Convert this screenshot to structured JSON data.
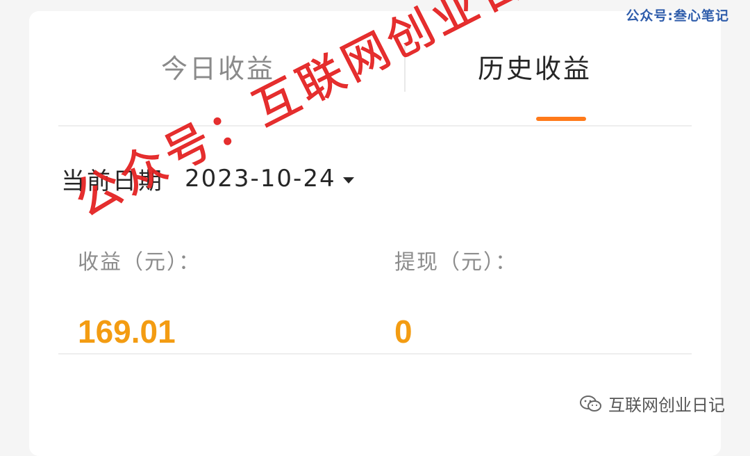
{
  "tabs": {
    "today": "今日收益",
    "history": "历史收益"
  },
  "date": {
    "label": "当前日期",
    "value": "2023-10-24"
  },
  "stats": {
    "income_label": "收益（元）：",
    "income_value": "169.01",
    "withdraw_label": "提现（元）：",
    "withdraw_value": "0"
  },
  "watermarks": {
    "top_right": "公众号:叁心笔记",
    "bottom_right": "互联网创业日记",
    "stamp": "公众号：互联网创业日记"
  },
  "colors": {
    "accent": "#f39c12",
    "underline": "#ff7a1a",
    "stamp": "#e32222",
    "top_watermark": "#2f5dab"
  }
}
